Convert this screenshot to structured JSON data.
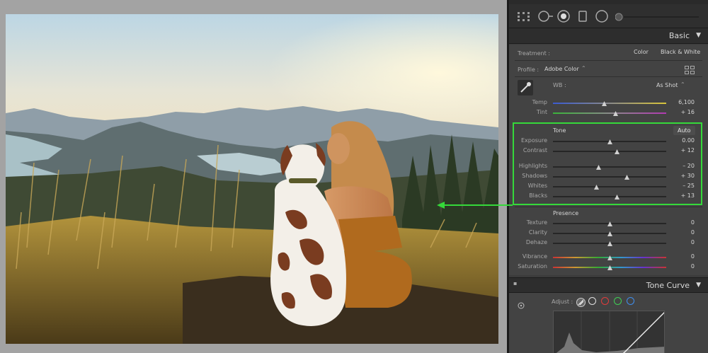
{
  "panel": {
    "basic": {
      "title": "Basic",
      "treatment": {
        "label": "Treatment :",
        "options": [
          "Color",
          "Black & White"
        ]
      },
      "profile": {
        "label": "Profile :",
        "value": "Adobe Color"
      },
      "wb": {
        "label": "WB :",
        "value": "As Shot"
      },
      "sliders": [
        {
          "key": "temp",
          "label": "Temp",
          "value": "6,100",
          "position": 0.45,
          "track": "temp"
        },
        {
          "key": "tint",
          "label": "Tint",
          "value": "+ 16",
          "position": 0.55,
          "track": "tint"
        },
        {
          "key": "exposure",
          "label": "Exposure",
          "value": "0.00",
          "position": 0.5,
          "track": "gray"
        },
        {
          "key": "contrast",
          "label": "Contrast",
          "value": "+ 12",
          "position": 0.56,
          "track": "gray"
        },
        {
          "key": "highlights",
          "label": "Highlights",
          "value": "– 20",
          "position": 0.4,
          "track": "gray"
        },
        {
          "key": "shadows",
          "label": "Shadows",
          "value": "+ 30",
          "position": 0.65,
          "track": "gray"
        },
        {
          "key": "whites",
          "label": "Whites",
          "value": "– 25",
          "position": 0.38,
          "track": "gray"
        },
        {
          "key": "blacks",
          "label": "Blacks",
          "value": "+ 13",
          "position": 0.56,
          "track": "gray"
        },
        {
          "key": "texture",
          "label": "Texture",
          "value": "0",
          "position": 0.5,
          "track": "gray"
        },
        {
          "key": "clarity",
          "label": "Clarity",
          "value": "0",
          "position": 0.5,
          "track": "gray"
        },
        {
          "key": "dehaze",
          "label": "Dehaze",
          "value": "0",
          "position": 0.5,
          "track": "gray"
        },
        {
          "key": "vibrance",
          "label": "Vibrance",
          "value": "0",
          "position": 0.5,
          "track": "rainbow"
        },
        {
          "key": "saturation",
          "label": "Saturation",
          "value": "0",
          "position": 0.5,
          "track": "rainbow"
        }
      ],
      "tone": {
        "label": "Tone",
        "auto": "Auto"
      },
      "presence": {
        "label": "Presence"
      }
    },
    "tone_curve": {
      "title": "Tone Curve",
      "adjust_label": "Adjust :"
    }
  },
  "colors": {
    "highlight_box": "#35d93a",
    "panel_bg": "#434343",
    "header_bg": "#2d2d2d"
  },
  "icons": [
    "grid-overlay-icon",
    "crop-icon",
    "mask-icon",
    "gradient-icon",
    "radial-icon",
    "eyedropper-icon",
    "profile-browser-icon",
    "collapse-triangle-icon",
    "target-adjust-icon",
    "parametric-curve-icon",
    "point-curve-white-icon",
    "point-curve-red-icon",
    "point-curve-green-icon",
    "point-curve-blue-icon"
  ]
}
